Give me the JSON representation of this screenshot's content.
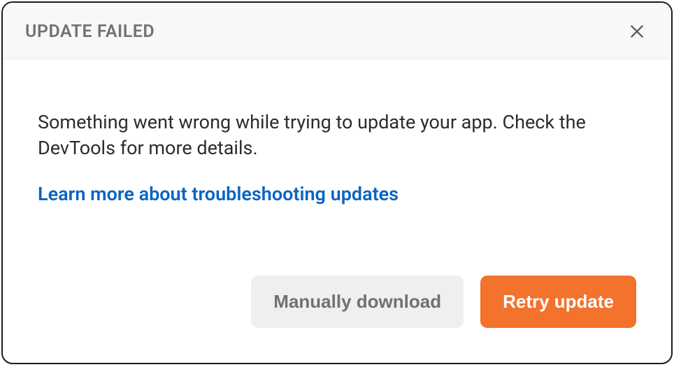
{
  "header": {
    "title": "UPDATE FAILED"
  },
  "body": {
    "message": "Something went wrong while trying to update your app. Check the DevTools for more details.",
    "link_text": "Learn more about troubleshooting updates"
  },
  "footer": {
    "secondary_label": "Manually download",
    "primary_label": "Retry update"
  }
}
